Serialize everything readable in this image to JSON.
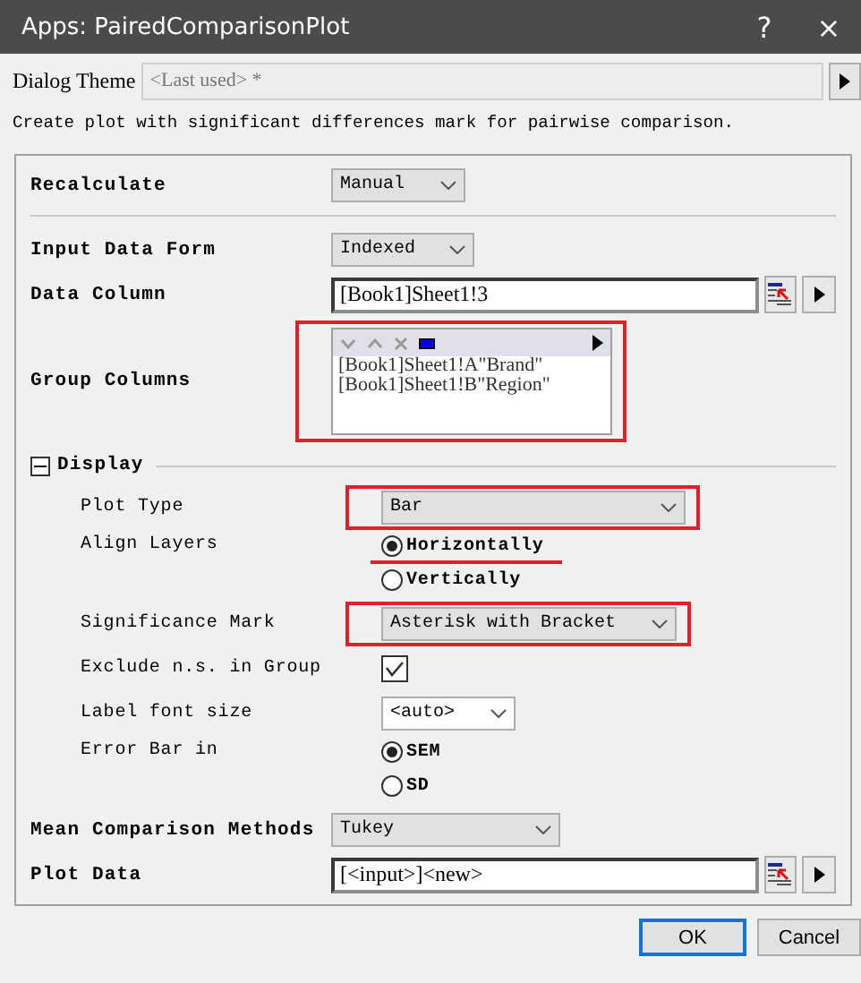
{
  "window": {
    "title": "Apps: PairedComparisonPlot",
    "help": "?",
    "close": "×"
  },
  "theme": {
    "label": "Dialog Theme",
    "value": "<Last used> *"
  },
  "description": "Create plot with significant differences mark for pairwise comparison.",
  "rows": [
    {
      "kind": "dropdown",
      "label": "Recalculate",
      "value": "Manual"
    },
    {
      "kind": "separator"
    },
    {
      "kind": "dropdown",
      "label": "Input Data Form",
      "value": "Indexed"
    },
    {
      "kind": "input",
      "label": "Data Column",
      "value": "[Book1]Sheet1!3"
    },
    {
      "kind": "listbox",
      "label": "Group Columns",
      "items": [
        "[Book1]Sheet1!A\"Brand\"",
        "[Book1]Sheet1!B\"Region\""
      ],
      "boxed": true
    },
    {
      "kind": "section",
      "label": "Display",
      "expanded": true,
      "children": [
        {
          "kind": "dropdown",
          "label": "Plot Type",
          "value": "Bar",
          "boxed": true
        },
        {
          "kind": "radio",
          "label": "Align Layers",
          "options": [
            {
              "label": "Horizontally",
              "selected": true,
              "underlined": true
            },
            {
              "label": "Vertically",
              "selected": false
            }
          ]
        },
        {
          "kind": "dropdown",
          "label": "Significance Mark",
          "value": "Asterisk with Bracket",
          "boxed": true
        },
        {
          "kind": "checkbox",
          "label": "Exclude n.s. in Group",
          "checked": true
        },
        {
          "kind": "dropdown",
          "label": "Label font size",
          "value": "<auto>",
          "editable": true
        },
        {
          "kind": "radio",
          "label": "Error Bar in",
          "options": [
            {
              "label": "SEM",
              "selected": true
            },
            {
              "label": "SD",
              "selected": false
            }
          ]
        }
      ]
    },
    {
      "kind": "dropdown",
      "label": "Mean Comparison Methods",
      "value": "Tukey"
    },
    {
      "kind": "input",
      "label": "Plot Data",
      "value": "[<input>]<new>"
    }
  ],
  "buttons": [
    {
      "label": "OK",
      "default": true
    },
    {
      "label": "Cancel",
      "default": false
    }
  ]
}
